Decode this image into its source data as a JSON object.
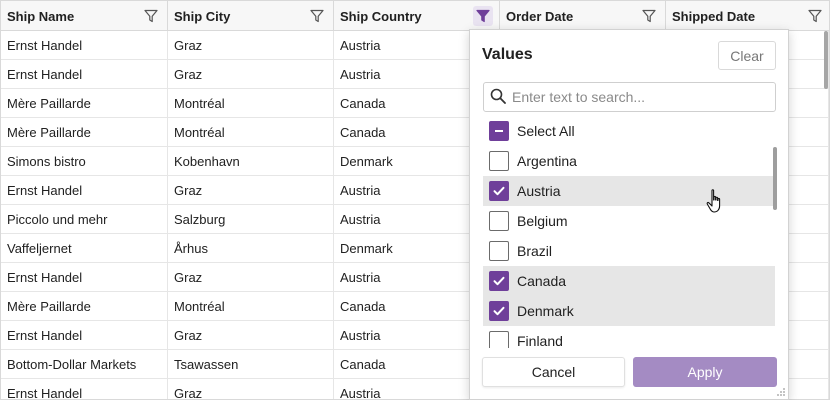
{
  "columns": [
    {
      "label": "Ship Name"
    },
    {
      "label": "Ship City"
    },
    {
      "label": "Ship Country"
    },
    {
      "label": "Order Date"
    },
    {
      "label": "Shipped Date"
    }
  ],
  "rows": [
    [
      "Ernst Handel",
      "Graz",
      "Austria"
    ],
    [
      "Ernst Handel",
      "Graz",
      "Austria"
    ],
    [
      "Mère Paillarde",
      "Montréal",
      "Canada"
    ],
    [
      "Mère Paillarde",
      "Montréal",
      "Canada"
    ],
    [
      "Simons bistro",
      "Kobenhavn",
      "Denmark"
    ],
    [
      "Ernst Handel",
      "Graz",
      "Austria"
    ],
    [
      "Piccolo und mehr",
      "Salzburg",
      "Austria"
    ],
    [
      "Vaffeljernet",
      "Århus",
      "Denmark"
    ],
    [
      "Ernst Handel",
      "Graz",
      "Austria"
    ],
    [
      "Mère Paillarde",
      "Montréal",
      "Canada"
    ],
    [
      "Ernst Handel",
      "Graz",
      "Austria"
    ],
    [
      "Bottom-Dollar Markets",
      "Tsawassen",
      "Canada"
    ],
    [
      "Ernst Handel",
      "Graz",
      "Austria"
    ]
  ],
  "filter_popup": {
    "title": "Values",
    "clear_label": "Clear",
    "search_placeholder": "Enter text to search...",
    "select_all_label": "Select All",
    "items": [
      {
        "label": "Argentina",
        "checked": false
      },
      {
        "label": "Austria",
        "checked": true
      },
      {
        "label": "Belgium",
        "checked": false
      },
      {
        "label": "Brazil",
        "checked": false
      },
      {
        "label": "Canada",
        "checked": true
      },
      {
        "label": "Denmark",
        "checked": true
      },
      {
        "label": "Finland",
        "checked": false
      }
    ],
    "cancel_label": "Cancel",
    "apply_label": "Apply"
  },
  "colors": {
    "accent": "#6f3f9a",
    "apply": "#a48bc3"
  },
  "icons": [
    "filter-icon",
    "search-icon",
    "check-icon",
    "minus-icon",
    "hand-pointer-icon"
  ]
}
